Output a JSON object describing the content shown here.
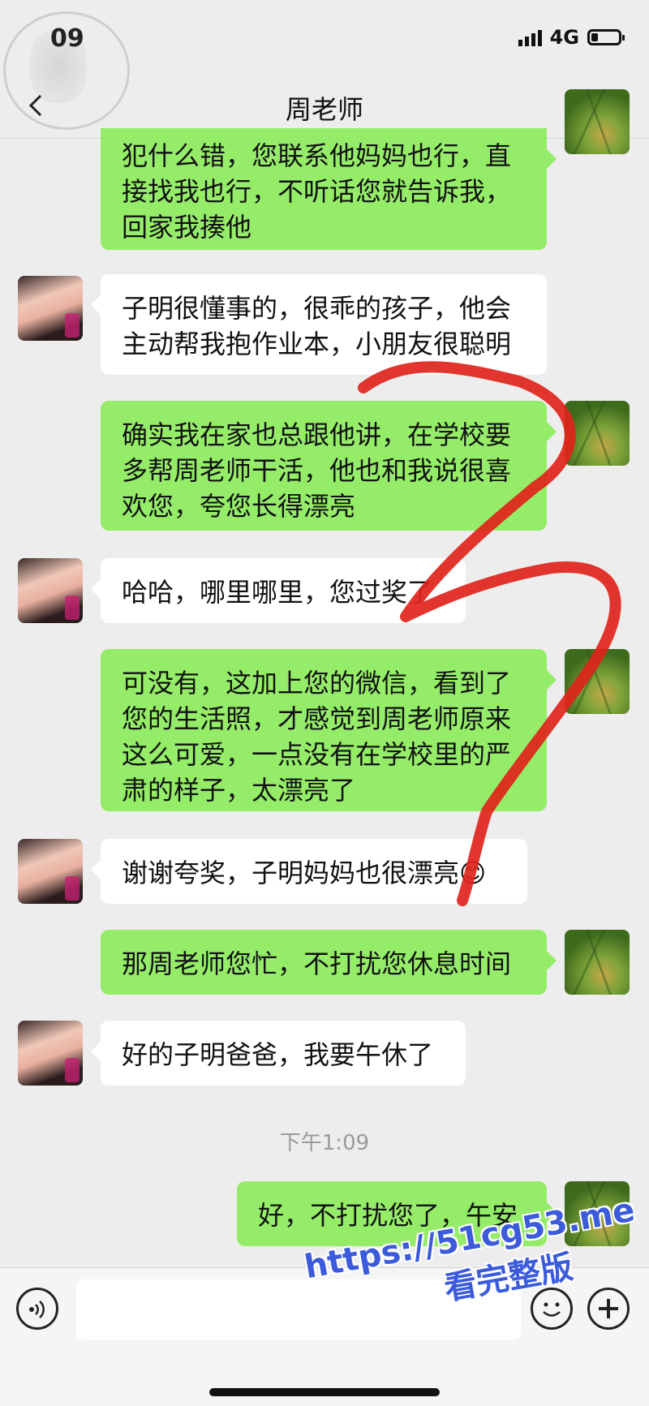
{
  "status_bar": {
    "time": "09",
    "network": "4G"
  },
  "header": {
    "title": "周老师",
    "more_label": "···"
  },
  "messages": [
    {
      "sender": "parent",
      "text": "犯什么错，您联系他妈妈也行，直接找我也行，不听话您就告诉我，回家我揍他"
    },
    {
      "sender": "teacher",
      "text": "子明很懂事的，很乖的孩子，他会主动帮我抱作业本，小朋友很聪明"
    },
    {
      "sender": "parent",
      "text": "确实我在家也总跟他讲，在学校要多帮周老师干活，他也和我说很喜欢您，夸您长得漂亮"
    },
    {
      "sender": "teacher",
      "text": "哈哈，哪里哪里，您过奖了"
    },
    {
      "sender": "parent",
      "text": "可没有，这加上您的微信，看到了您的生活照，才感觉到周老师原来这么可爱，一点没有在学校里的严肃的样子，太漂亮了"
    },
    {
      "sender": "teacher",
      "text": "谢谢夸奖，子明妈妈也很漂亮😊"
    },
    {
      "sender": "parent",
      "text": "那周老师您忙，不打扰您休息时间"
    },
    {
      "sender": "teacher",
      "text": "好的子明爸爸，我要午休了"
    },
    {
      "sender": "parent",
      "text": "好，不打扰您了，午安"
    }
  ],
  "timestamp": "下午1:09",
  "input": {
    "value": "",
    "placeholder": ""
  },
  "watermark": {
    "line1": "https://51cg53.me",
    "line2": "看完整版"
  },
  "colors": {
    "bubble_out": "#95ec69",
    "bubble_in": "#ffffff",
    "background": "#ededed",
    "annotation": "#e0241b"
  }
}
